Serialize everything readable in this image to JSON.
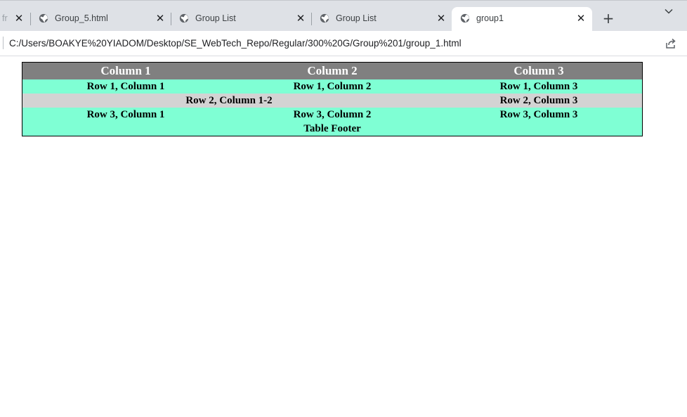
{
  "browser": {
    "tabs": [
      {
        "title": "fr",
        "state": "clipped"
      },
      {
        "title": "Group_5.html",
        "state": "inactive"
      },
      {
        "title": "Group List",
        "state": "inactive"
      },
      {
        "title": "Group List",
        "state": "inactive"
      },
      {
        "title": "group1",
        "state": "active"
      }
    ],
    "close_glyph": "✕",
    "new_tab_glyph": "+",
    "address": "C:/Users/BOAKYE%20YIADOM/Desktop/SE_WebTech_Repo/Regular/300%20G/Group%201/group_1.html"
  },
  "table": {
    "headers": [
      "Column 1",
      "Column 2",
      "Column 3"
    ],
    "rows": [
      {
        "cells": [
          "Row 1, Column 1",
          "Row 1, Column 2",
          "Row 1, Column 3"
        ],
        "background": "#7fffd4"
      },
      {
        "cells": [
          "Row 2, Column 1-2",
          "Row 2, Column 3"
        ],
        "background": "#d3d3d3"
      },
      {
        "cells": [
          "Row 3, Column 1",
          "Row 3, Column 2",
          "Row 3, Column 3"
        ],
        "background": "#7fffd4"
      }
    ],
    "footer": "Table Footer",
    "header_background": "#808080"
  },
  "icons": {
    "favicon": "globe-icon",
    "share": "share-icon",
    "tab_search": "chevron-down-icon"
  }
}
